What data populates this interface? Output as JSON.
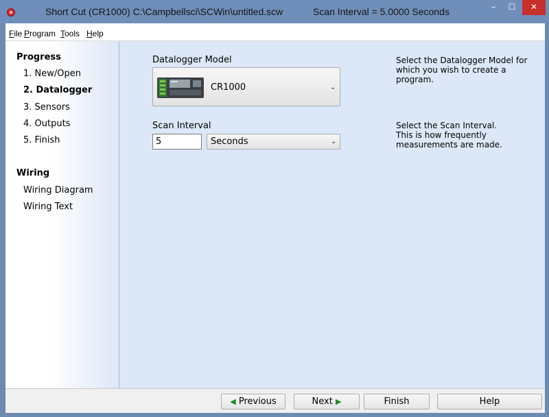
{
  "window": {
    "title": "Short Cut (CR1000) C:\\Campbellsci\\SCWin\\untitled.scw",
    "scan_interval_title": "Scan Interval = 5.0000 Seconds",
    "min_glyph": "–",
    "max_glyph": "☐",
    "close_glyph": "✕"
  },
  "menu": {
    "items": [
      {
        "accel": "F",
        "rest": "ile"
      },
      {
        "accel": "P",
        "rest": "rogram"
      },
      {
        "accel": "T",
        "rest": "ools"
      },
      {
        "accel": "H",
        "rest": "elp"
      }
    ]
  },
  "sidebar": {
    "progress_heading": "Progress",
    "progress_items": [
      "1. New/Open",
      "2. Datalogger",
      "3. Sensors",
      "4. Outputs",
      "5. Finish"
    ],
    "active_index": 1,
    "wiring_heading": "Wiring",
    "wiring_items": [
      "Wiring Diagram",
      "Wiring Text"
    ]
  },
  "main": {
    "model_label": "Datalogger Model",
    "model_value": "CR1000",
    "model_desc": [
      "Select the Datalogger Model for",
      "which you wish to create a",
      "program."
    ],
    "scan_label": "Scan Interval",
    "scan_value": "5",
    "scan_unit": "Seconds",
    "scan_desc": [
      "Select the Scan Interval.",
      "This is how frequently",
      "measurements are made."
    ],
    "dropdown_glyph": "⌄"
  },
  "buttons": {
    "previous": "Previous",
    "next": "Next",
    "finish": "Finish",
    "help": "Help",
    "prev_arrow": "◀",
    "next_arrow": "▶"
  },
  "colors": {
    "accent_titlebar": "#6f8fba",
    "panel_background": "#dce7f7",
    "close_button": "#c7302a",
    "arrow_green": "#1c8a1c"
  }
}
